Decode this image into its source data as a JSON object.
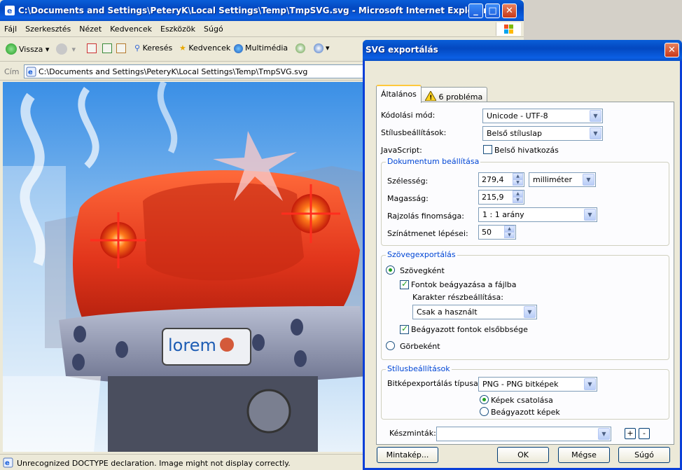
{
  "ie": {
    "title": "C:\\Documents and Settings\\PeteryK\\Local Settings\\Temp\\TmpSVG.svg - Microsoft Internet Explorer",
    "menu": [
      "Fájl",
      "Szerkesztés",
      "Nézet",
      "Kedvencek",
      "Eszközök",
      "Súgó"
    ],
    "toolbar": {
      "back": "Vissza",
      "search": "Keresés",
      "favorites": "Kedvencek",
      "media": "Multimédia"
    },
    "address_label": "Cím",
    "address_value": "C:\\Documents and Settings\\PeteryK\\Local Settings\\Temp\\TmpSVG.svg",
    "status": "Unrecognized DOCTYPE declaration. Image might not display correctly.",
    "plate_text": "lorem"
  },
  "dialog": {
    "title": "SVG exportálás",
    "tabs": [
      "Általános",
      "6 probléma"
    ],
    "encoding": {
      "label": "Kódolási mód:",
      "value": "Unicode - UTF-8"
    },
    "style": {
      "label": "Stílusbeállítások:",
      "value": "Belső stíluslap"
    },
    "javascript": {
      "label": "JavaScript:",
      "checkbox": "Belső hivatkozás",
      "checked": false
    },
    "document": {
      "group_title": "Dokumentum beállítása",
      "width_label": "Szélesség:",
      "width_value": "279,4",
      "unit_value": "milliméter",
      "height_label": "Magasság:",
      "height_value": "215,9",
      "precision_label": "Rajzolás finomsága:",
      "precision_value": "1 : 1 arány",
      "gradient_label": "Színátmenet lépései:",
      "gradient_value": "50"
    },
    "text_export": {
      "group_title": "Szövegexportálás",
      "as_text": "Szövegként",
      "as_text_selected": true,
      "embed_fonts": "Fontok beágyazása a fájlba",
      "embed_fonts_checked": true,
      "subset_label": "Karakter részbeállítása:",
      "subset_value": "Csak a használt",
      "embedded_priority": "Beágyazott fontok elsőbbsége",
      "embedded_priority_checked": true,
      "as_curves": "Görbeként",
      "as_curves_selected": false
    },
    "style_settings": {
      "group_title": "Stílusbeállítások",
      "bitmap_label": "Bitképexportálás típusa:",
      "bitmap_value": "PNG - PNG bitképek",
      "link_images": "Képek csatolása",
      "link_selected": true,
      "embed_images": "Beágyazott képek",
      "embed_selected": false
    },
    "presets_label": "Készminták:",
    "presets_value": "",
    "buttons": {
      "sample": "Mintakép...",
      "ok": "OK",
      "cancel": "Mégse",
      "help": "Súgó",
      "add": "+",
      "remove": "-"
    }
  },
  "colors": {
    "xp_blue": "#0a5ed8",
    "close_red": "#c8391a",
    "group_title": "#0046d5"
  }
}
